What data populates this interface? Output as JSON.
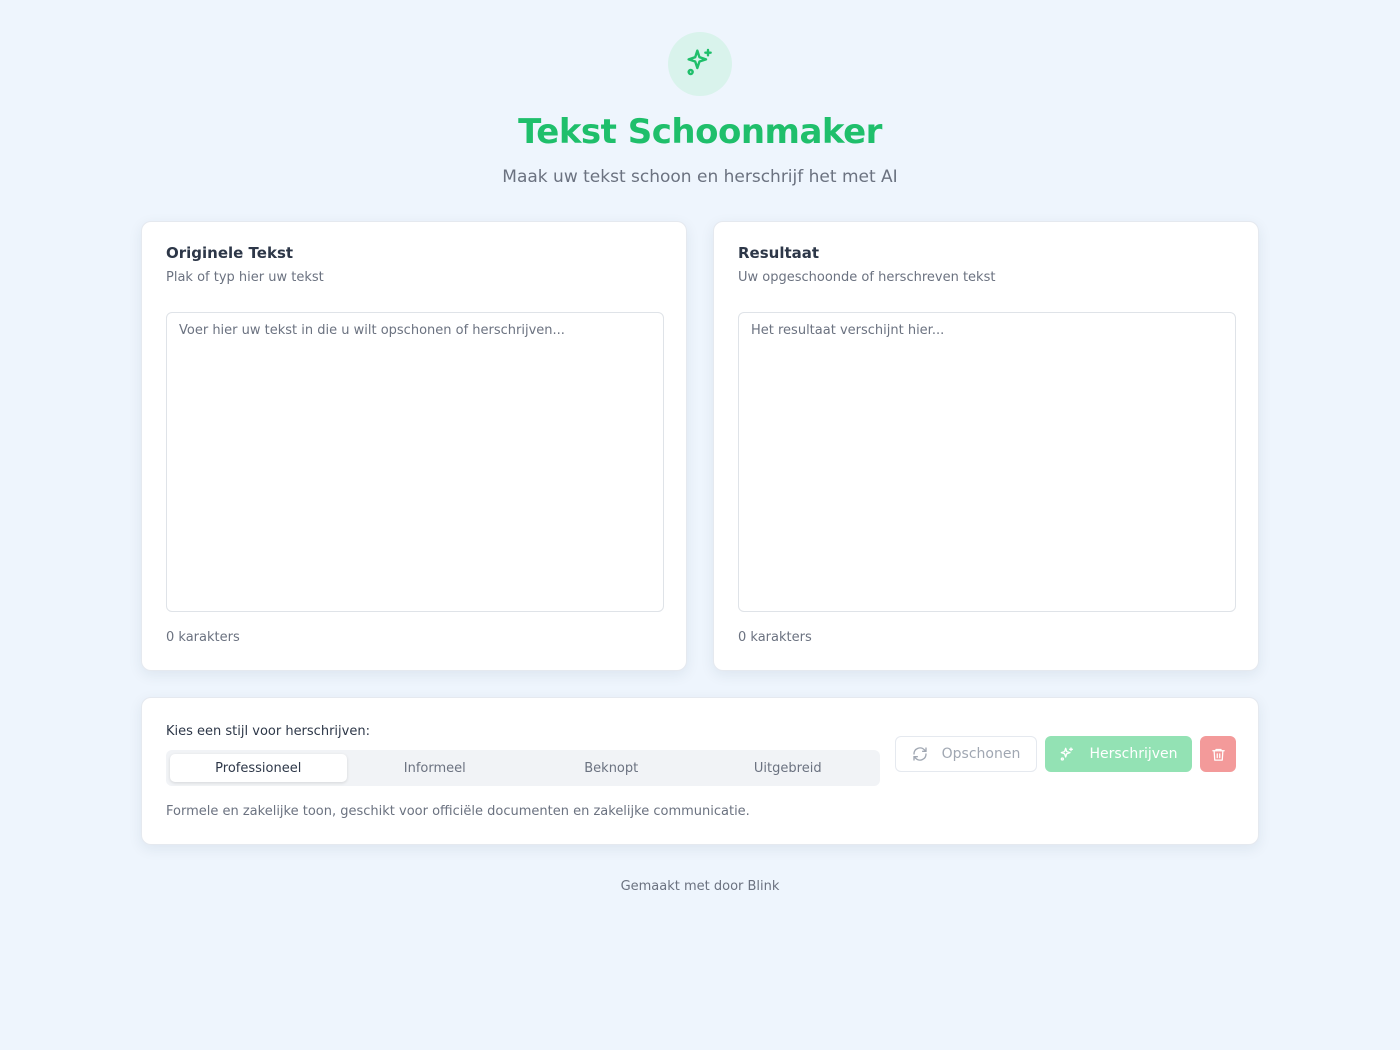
{
  "header": {
    "logo_icon": "sparkles-icon",
    "title": "Tekst Schoonmaker",
    "subtitle": "Maak uw tekst schoon en herschrijf het met AI"
  },
  "input_card": {
    "title": "Originele Tekst",
    "description": "Plak of typ hier uw tekst",
    "placeholder": "Voer hier uw tekst in die u wilt opschonen of herschrijven...",
    "value": "",
    "char_count": "0 karakters"
  },
  "output_card": {
    "title": "Resultaat",
    "description": "Uw opgeschoonde of herschreven tekst",
    "placeholder": "Het resultaat verschijnt hier...",
    "value": "",
    "char_count": "0 karakters"
  },
  "controls": {
    "style_label": "Kies een stijl voor herschrijven:",
    "styles": [
      "Professioneel",
      "Informeel",
      "Beknopt",
      "Uitgebreid"
    ],
    "selected_style": "Professioneel",
    "style_description": "Formele en zakelijke toon, geschikt voor officiële documenten en zakelijke communicatie.",
    "clean_button": "Opschonen",
    "rewrite_button": "Herschrijven",
    "delete_icon": "trash-icon"
  },
  "footer": {
    "text": "Gemaakt met  door Blink"
  },
  "colors": {
    "accent": "#1fbf6b",
    "rewrite_button": "#93e2b4",
    "delete_button": "#f39a9a",
    "background": "#eef5fd"
  }
}
